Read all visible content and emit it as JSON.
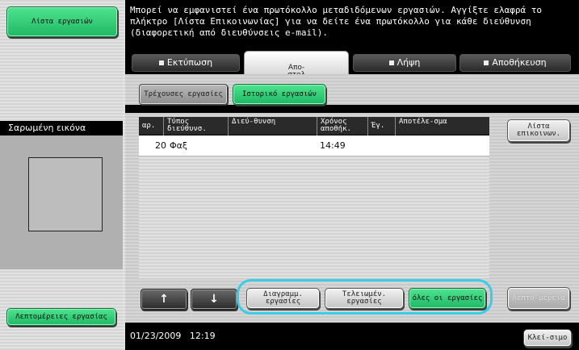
{
  "left": {
    "job_list_label": "Λίστα εργασιών",
    "scanned_image_label": "Σαρωμένη εικόνα",
    "job_details_label": "Λεπτομέρειες εργασίας"
  },
  "message": {
    "line1": "Μπορεί να εμφανιστεί ένα πρωτόκολλο μεταδιδόμενων εργασιών. Αγγίξτε ελαφρά το",
    "line2": "πλήκτρο [Λίστα Επικοινωνίας] για να δείτε ένα πρωτόκολλο για κάθε διεύθυνση",
    "line3": "(διαφορετική από διευθύνσεις e-mail)."
  },
  "tabs": {
    "print": "Εκτύπωση",
    "send": "Απο-\nστολ",
    "receive": "Λήψη",
    "save": "Αποθήκευση"
  },
  "subtabs": {
    "current": "Τρέχουσες εργασίες",
    "history": "Ιστορικό εργασιών"
  },
  "table": {
    "headers": [
      "αρ.",
      "Τύπος διεύθυνσ.",
      "Διεύ-θυνση",
      "Χρόνος αποθήκ.",
      "Έγ.",
      "Αποτέλε-σμα"
    ],
    "rows": [
      {
        "no": "20",
        "type": "Φαξ",
        "address": "",
        "time": "14:49",
        "docs": "",
        "result": ""
      }
    ]
  },
  "buttons": {
    "contact_list": "Λίστα επικοινων.",
    "details": "Λεπτο-μέρεια",
    "up": "↑",
    "down": "↓",
    "deleted_jobs": "Διαγραμμ. εργασίες",
    "completed_jobs": "Τελειωμέν. εργασίες",
    "all_jobs": "όλες οι εργασίες",
    "close": "Κλεί-σιμο"
  },
  "footer": {
    "date": "01/23/2009",
    "time": "12:19"
  },
  "colors": {
    "accent_green": "#2fd07a",
    "highlight_cyan": "#39cde6"
  }
}
